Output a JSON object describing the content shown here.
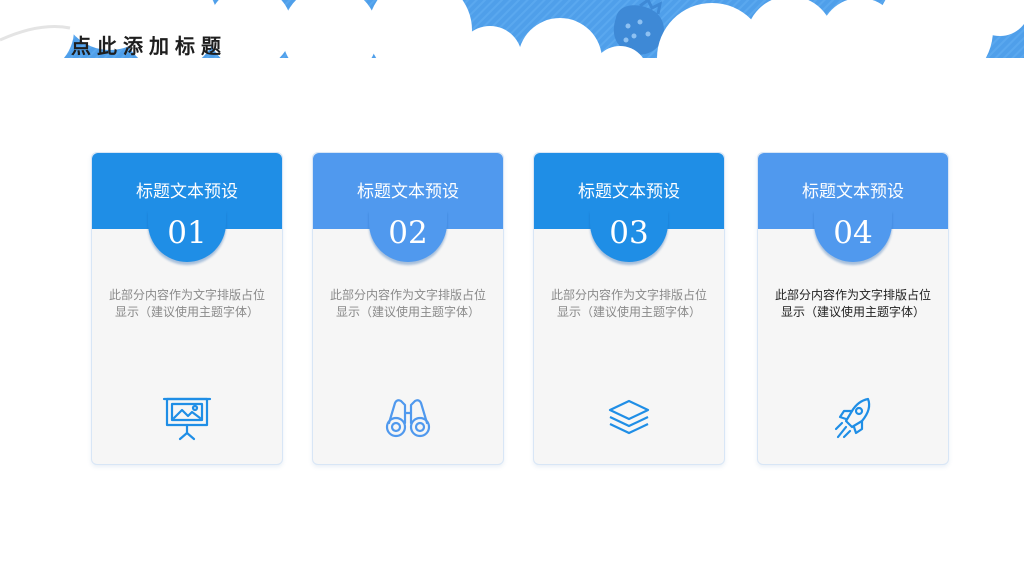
{
  "page": {
    "title": "点此添加标题"
  },
  "colors": {
    "accent_dark": "#1f8ee6",
    "accent_light": "#5099ee",
    "sky": "#4a9be8"
  },
  "cards": [
    {
      "heading": "标题文本预设",
      "number": "01",
      "text": "此部分内容作为文字排版占位显示（建议使用主题字体）",
      "icon": "presentation-board-icon"
    },
    {
      "heading": "标题文本预设",
      "number": "02",
      "text": "此部分内容作为文字排版占位显示（建议使用主题字体）",
      "icon": "binoculars-icon"
    },
    {
      "heading": "标题文本预设",
      "number": "03",
      "text": "此部分内容作为文字排版占位显示（建议使用主题字体）",
      "icon": "layers-icon"
    },
    {
      "heading": "标题文本预设",
      "number": "04",
      "text": "此部分内容作为文字排版占位显示（建议使用主题字体）",
      "icon": "rocket-icon"
    }
  ]
}
